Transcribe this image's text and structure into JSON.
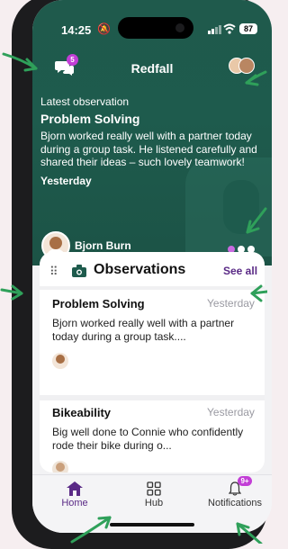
{
  "status": {
    "time": "14:25",
    "battery": "87"
  },
  "header": {
    "title": "Redfall",
    "chat_badge": "5"
  },
  "hero": {
    "kicker": "Latest observation",
    "title": "Problem Solving",
    "body": "Bjorn worked really well with a partner today during a group task. He listened carefully and shared their ideas – such lovely teamwork!",
    "date": "Yesterday",
    "child_name": "Bjorn Burn",
    "pagination_active": 0,
    "pagination_count": 3
  },
  "observations": {
    "title": "Observations",
    "see_all": "See all",
    "items": [
      {
        "title": "Problem Solving",
        "date": "Yesterday",
        "snippet": "Bjorn worked really well with a partner today during a group task...."
      },
      {
        "title": "Bikeability",
        "date": "Yesterday",
        "snippet": "Big well done to Connie who confidently rode their bike during o..."
      }
    ]
  },
  "tabbar": {
    "home": "Home",
    "hub": "Hub",
    "notifications": "Notifications",
    "notif_badge": "9+"
  },
  "colors": {
    "accent": "#1e5b4d",
    "tab_active": "#5a2a86",
    "badge": "#c23ed6",
    "annotation_arrow": "#2fa05a"
  }
}
